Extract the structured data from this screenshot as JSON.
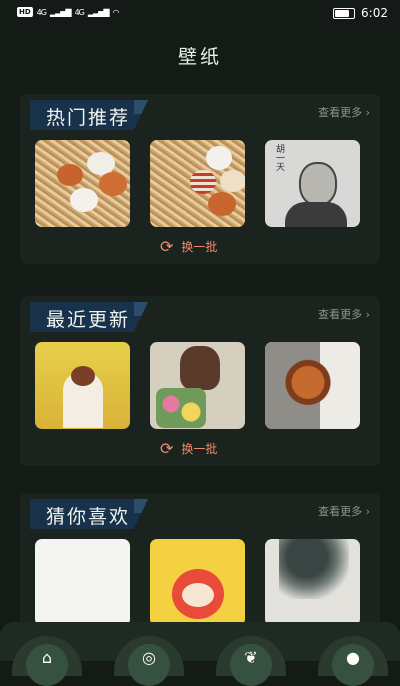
{
  "status_bar": {
    "left_badge": "HD",
    "network1": "4G",
    "network2": "4G",
    "time": "6:02",
    "battery_level": 0.9
  },
  "page": {
    "title": "壁纸"
  },
  "sections": [
    {
      "title": "热门推荐",
      "more_label": "查看更多 ›",
      "refresh_label": "换一批",
      "refresh_icon": "refresh-icon"
    },
    {
      "title": "最近更新",
      "more_label": "查看更多 ›",
      "refresh_label": "换一批",
      "refresh_icon": "refresh-icon"
    },
    {
      "title": "猜你喜欢",
      "more_label": "查看更多 ›"
    }
  ],
  "thumbnails": {
    "sketch_text": "胡一天"
  },
  "bottom_nav": {
    "icons": [
      "home-icon",
      "compass-icon",
      "leaf-icon",
      "profile-icon"
    ]
  },
  "colors": {
    "background": "#141b16",
    "section_bg": "#1a231d",
    "title_tag": "#17324a",
    "accent": "#ef8b6a"
  }
}
